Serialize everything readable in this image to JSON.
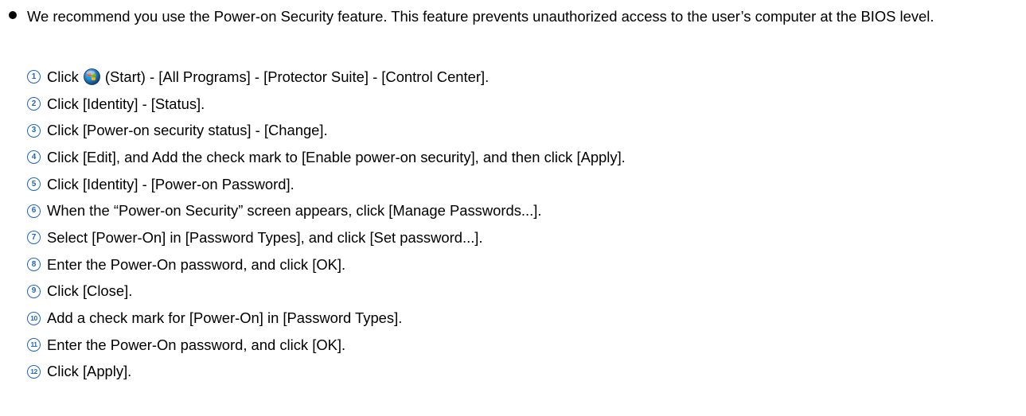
{
  "intro": {
    "text": "We recommend you use the Power-on Security feature. This feature prevents unauthorized access to the user’s computer at the BIOS level."
  },
  "steps": [
    {
      "num": "1",
      "before_icon": "Click",
      "icon": "windows-start-icon",
      "after_icon": "(Start) - [All Programs] - [Protector Suite] - [Control Center]."
    },
    {
      "num": "2",
      "text": "Click [Identity] - [Status]."
    },
    {
      "num": "3",
      "text": "Click [Power-on security status] - [Change]."
    },
    {
      "num": "4",
      "text": "Click [Edit], and Add the check mark to [Enable power-on security], and then click [Apply]."
    },
    {
      "num": "5",
      "text": "Click [Identity] - [Power-on Password]."
    },
    {
      "num": "6",
      "text": "When the “Power-on Security” screen appears, click [Manage Passwords...]."
    },
    {
      "num": "7",
      "text": "Select [Power-On] in [Password Types], and click [Set password...]."
    },
    {
      "num": "8",
      "text": "Enter the Power-On password, and click [OK]."
    },
    {
      "num": "9",
      "text": "Click [Close]."
    },
    {
      "num": "10",
      "text": "Add a check mark for [Power-On] in [Password Types]."
    },
    {
      "num": "11",
      "text": "Enter the Power-On password, and click [OK]."
    },
    {
      "num": "12",
      "text": "Click [Apply]."
    }
  ],
  "colors": {
    "step_number": "#1F66C0",
    "text": "#000000"
  }
}
